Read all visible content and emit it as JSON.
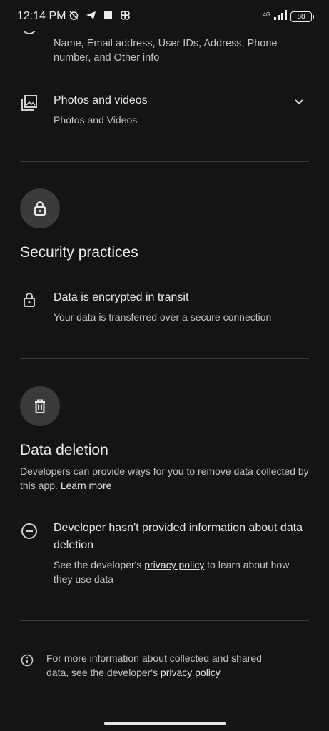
{
  "status_bar": {
    "time": "12:14 PM",
    "network": "4G",
    "battery": "88"
  },
  "personal_info": {
    "description": "Name, Email address, User IDs, Address, Phone number, and Other info"
  },
  "photos": {
    "title": "Photos and videos",
    "subtitle": "Photos and Videos"
  },
  "security": {
    "title": "Security practices",
    "item_title": "Data is encrypted in transit",
    "item_subtitle": "Your data is transferred over a secure connection"
  },
  "deletion": {
    "title": "Data deletion",
    "description": "Developers can provide ways for you to remove data collected by this app.",
    "learn_more": "Learn more",
    "item_title": "Developer hasn't provided information about data deletion",
    "item_text_before": "See the developer's",
    "privacy_link": "privacy policy",
    "item_text_after": "to learn about how they use data"
  },
  "footer": {
    "text_before": "For more information about collected and shared data, see the developer's",
    "privacy_link": "privacy policy"
  }
}
